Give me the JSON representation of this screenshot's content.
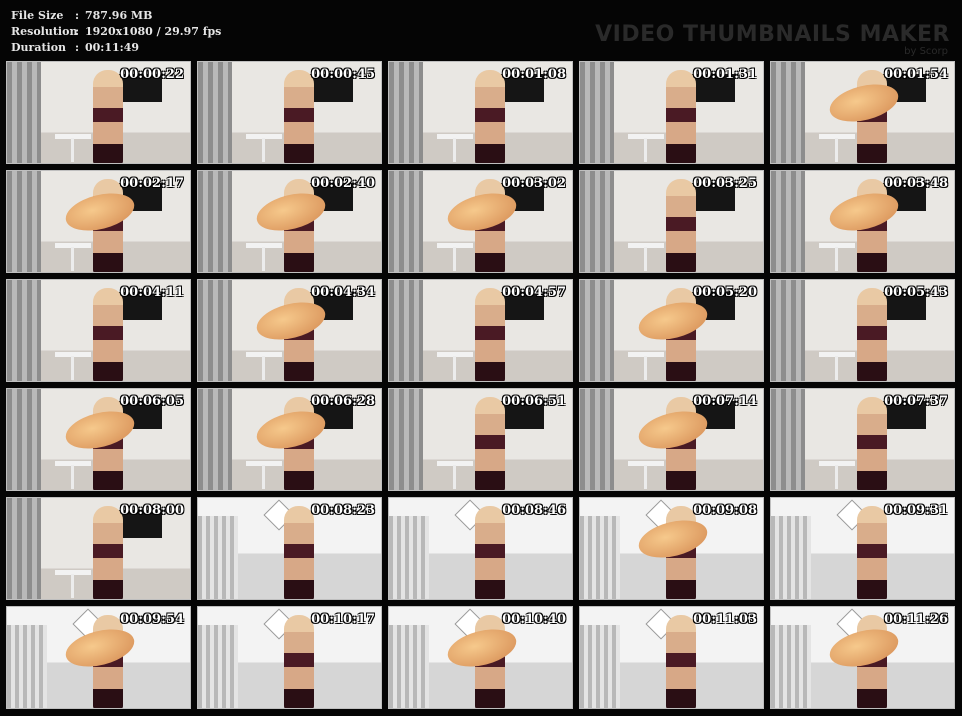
{
  "header": {
    "file_size_label": "File Size",
    "file_size_value": "787.96 MB",
    "resolution_label": "Resolution",
    "resolution_value": "1920x1080 / 29.97 fps",
    "duration_label": "Duration",
    "duration_value": "00:11:49",
    "separator": ":",
    "brand_title": "VIDEO THUMBNAILS MAKER",
    "brand_sub": "by Scorp"
  },
  "thumbnails": [
    {
      "time": "00:00:22",
      "scene": "room"
    },
    {
      "time": "00:00:45",
      "scene": "room"
    },
    {
      "time": "00:01:08",
      "scene": "room"
    },
    {
      "time": "00:01:31",
      "scene": "room"
    },
    {
      "time": "00:01:54",
      "scene": "foot"
    },
    {
      "time": "00:02:17",
      "scene": "foot"
    },
    {
      "time": "00:02:40",
      "scene": "foot"
    },
    {
      "time": "00:03:02",
      "scene": "foot"
    },
    {
      "time": "00:03:25",
      "scene": "room"
    },
    {
      "time": "00:03:48",
      "scene": "foot"
    },
    {
      "time": "00:04:11",
      "scene": "room"
    },
    {
      "time": "00:04:34",
      "scene": "foot"
    },
    {
      "time": "00:04:57",
      "scene": "room"
    },
    {
      "time": "00:05:20",
      "scene": "foot"
    },
    {
      "time": "00:05:43",
      "scene": "room"
    },
    {
      "time": "00:06:05",
      "scene": "foot"
    },
    {
      "time": "00:06:28",
      "scene": "foot"
    },
    {
      "time": "00:06:51",
      "scene": "room"
    },
    {
      "time": "00:07:14",
      "scene": "foot"
    },
    {
      "time": "00:07:37",
      "scene": "room"
    },
    {
      "time": "00:08:00",
      "scene": "room"
    },
    {
      "time": "00:08:23",
      "scene": "low"
    },
    {
      "time": "00:08:46",
      "scene": "low"
    },
    {
      "time": "00:09:08",
      "scene": "low-foot"
    },
    {
      "time": "00:09:31",
      "scene": "low"
    },
    {
      "time": "00:09:54",
      "scene": "low-foot"
    },
    {
      "time": "00:10:17",
      "scene": "low"
    },
    {
      "time": "00:10:40",
      "scene": "low-foot"
    },
    {
      "time": "00:11:03",
      "scene": "low"
    },
    {
      "time": "00:11:26",
      "scene": "low-foot"
    }
  ]
}
